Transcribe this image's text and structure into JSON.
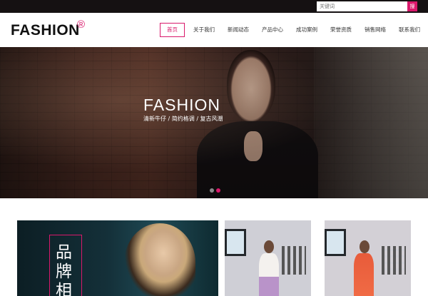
{
  "search": {
    "placeholder": "关键词",
    "button_label": "搜"
  },
  "header": {
    "logo_text": "FASHION",
    "logo_mark": "®",
    "nav": [
      {
        "label": "首页",
        "active": true
      },
      {
        "label": "关于我们"
      },
      {
        "label": "新闻动态"
      },
      {
        "label": "产品中心"
      },
      {
        "label": "成功案例"
      },
      {
        "label": "荣誉资质"
      },
      {
        "label": "销售网络"
      },
      {
        "label": "联系我们"
      }
    ]
  },
  "banner": {
    "title": "FASHION",
    "subtitle": "清新牛仔 / 简约格调 / 复古风潮",
    "slides": 2,
    "active_slide": 2
  },
  "cards": {
    "card1_text": "品牌相"
  },
  "colors": {
    "accent": "#d9196b",
    "topbar": "#151112"
  }
}
